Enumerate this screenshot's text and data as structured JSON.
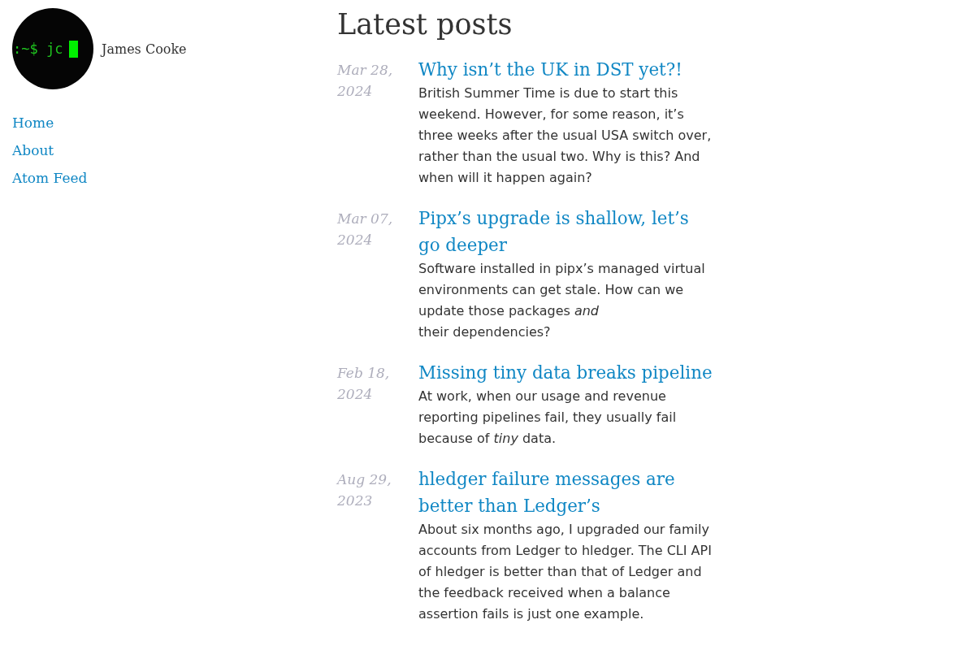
{
  "sidebar": {
    "avatar": {
      "prompt": ":~$ jc"
    },
    "name": "James Cooke",
    "nav": [
      {
        "label": "Home"
      },
      {
        "label": "About"
      },
      {
        "label": "Atom Feed"
      }
    ]
  },
  "main": {
    "heading": "Latest posts",
    "posts": [
      {
        "date": "Mar 28, 2024",
        "title": "Why isn’t the UK in DST yet?!",
        "summary": "British Summer Time is due to start this weekend. However, for some reason, it’s three weeks after the usual USA switch over, rather than the usual two. Why is this? And when will it happen again?"
      },
      {
        "date": "Mar 07, 2024",
        "title": "Pipx’s upgrade is shallow, let’s go deeper",
        "summary": "Software installed in pipx’s managed virtual environments can get stale. How can we update those packages *and*\ntheir dependencies?"
      },
      {
        "date": "Feb 18, 2024",
        "title": "Missing tiny data breaks pipeline",
        "summary": "At work, when our usage and revenue reporting pipelines fail, they usually fail because of *tiny* data."
      },
      {
        "date": "Aug 29, 2023",
        "title": "hledger failure messages are better than Ledger’s",
        "summary": "About six months ago, I upgraded our family accounts from Ledger to hledger. The CLI API of hledger is better than that of Ledger and the feedback received when a balance assertion fails is just one example."
      }
    ]
  }
}
